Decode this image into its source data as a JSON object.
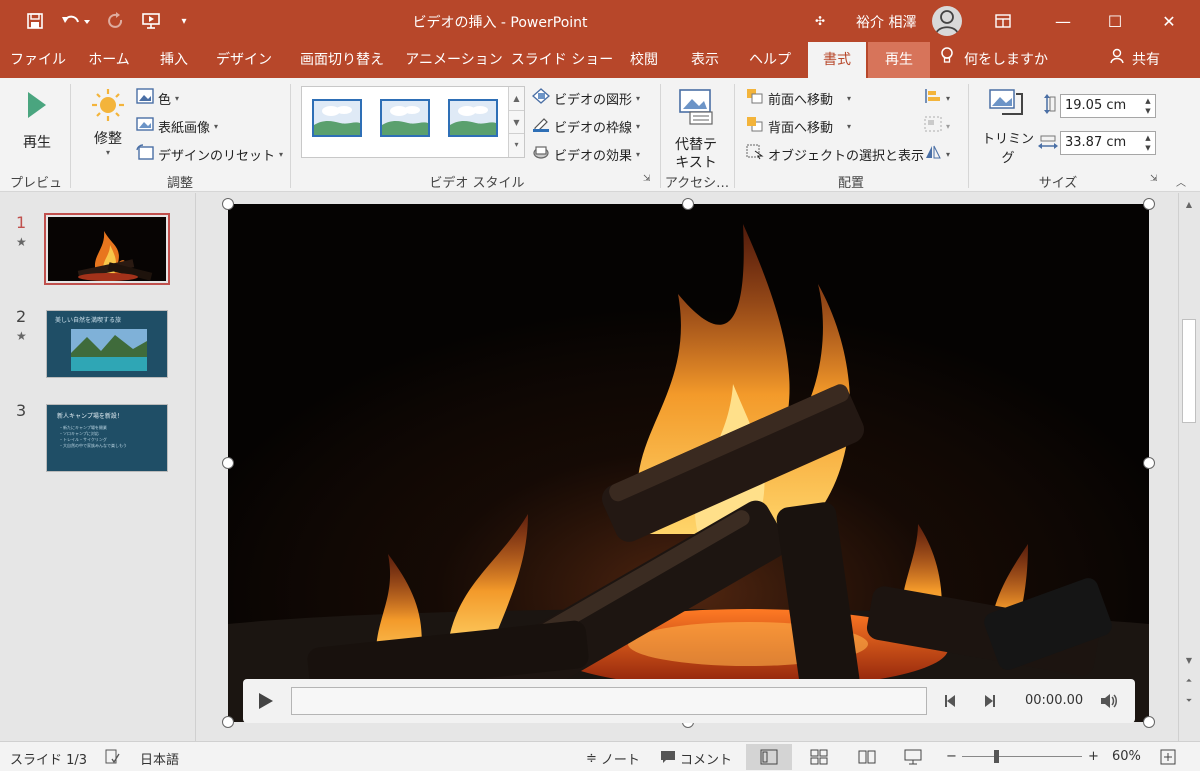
{
  "window": {
    "title": "ビデオの挿入 - PowerPoint",
    "user_name": "裕介 相澤",
    "controls": {
      "minimize": "—",
      "maximize": "☐",
      "close": "✕"
    }
  },
  "tabs": [
    {
      "label": "ファイル"
    },
    {
      "label": "ホーム"
    },
    {
      "label": "挿入"
    },
    {
      "label": "デザイン"
    },
    {
      "label": "画面切り替え"
    },
    {
      "label": "アニメーション"
    },
    {
      "label": "スライド ショー"
    },
    {
      "label": "校閲"
    },
    {
      "label": "表示"
    },
    {
      "label": "ヘルプ"
    },
    {
      "label": "書式"
    },
    {
      "label": "再生"
    }
  ],
  "tell_me": "何をしますか",
  "share": "共有",
  "ribbon": {
    "preview": {
      "play": "再生",
      "label": "プレビュー"
    },
    "adjust": {
      "corrections": "修整",
      "color": "色",
      "poster_frame": "表紙画像",
      "reset_design": "デザインのリセット",
      "label": "調整"
    },
    "video_styles": {
      "shape": "ビデオの図形",
      "border": "ビデオの枠線",
      "effects": "ビデオの効果",
      "label": "ビデオ スタイル"
    },
    "accessibility": {
      "alt_text_1": "代替テ",
      "alt_text_2": "キスト",
      "label": "アクセシ…"
    },
    "arrange": {
      "bring_forward": "前面へ移動",
      "send_backward": "背面へ移動",
      "selection_pane": "オブジェクトの選択と表示",
      "label": "配置"
    },
    "size": {
      "crop": "トリミング",
      "height": "19.05 cm",
      "width": "33.87 cm",
      "label": "サイズ"
    }
  },
  "slides": [
    {
      "number": "1",
      "starred": true,
      "kind": "fire",
      "title": "",
      "bullets": []
    },
    {
      "number": "2",
      "starred": true,
      "kind": "lake",
      "title": "美しい自然を満喫する旅",
      "bullets": []
    },
    {
      "number": "3",
      "starred": false,
      "kind": "text",
      "title": "新人キャンプ場を新設！",
      "bullets": [
        "・新たにキャンプ場を開業",
        "・ソロキャンプに対応",
        "・トレイル・サイクリング",
        "・大自然の中で家族みんなで楽しもう"
      ]
    }
  ],
  "player": {
    "time": "00:00.00"
  },
  "status": {
    "slide": "スライド 1/3",
    "language": "日本語",
    "notes": "ノート",
    "comments": "コメント",
    "zoom": "60%"
  },
  "colors": {
    "accent": "#b7472a",
    "selection_border": "#c0504d"
  }
}
